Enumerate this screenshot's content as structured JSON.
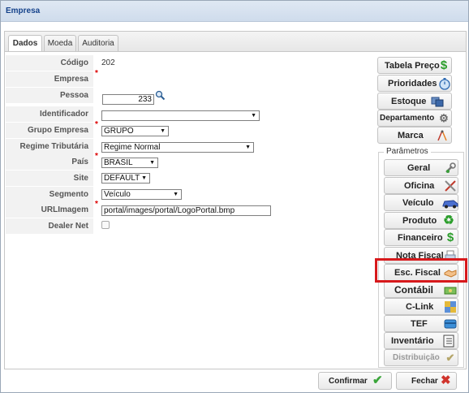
{
  "window": {
    "title": "Empresa"
  },
  "tabs": [
    {
      "label": "Dados",
      "active": true
    },
    {
      "label": "Moeda",
      "active": false
    },
    {
      "label": "Auditoria",
      "active": false
    }
  ],
  "form": {
    "codigo": {
      "label": "Código",
      "value": "202"
    },
    "empresa": {
      "label": "Empresa",
      "value": ""
    },
    "pessoa": {
      "label": "Pessoa",
      "value": "233"
    },
    "identificador": {
      "label": "Identificador",
      "value": ""
    },
    "grupo_empresa": {
      "label": "Grupo Empresa",
      "value": "GRUPO"
    },
    "regime_tributario": {
      "label": "Regime Tributária",
      "value": "Regime Normal"
    },
    "pais": {
      "label": "País",
      "value": "BRASIL"
    },
    "site": {
      "label": "Site",
      "value": "DEFAULT"
    },
    "segmento": {
      "label": "Segmento",
      "value": "Veículo"
    },
    "url_imagem": {
      "label": "URLImagem",
      "value": "portal/images/portal/LogoPortal.bmp"
    },
    "dealer_net": {
      "label": "Dealer Net",
      "checked": false
    }
  },
  "side_buttons": [
    {
      "label": "Tabela Preço",
      "icon": "dollar-icon"
    },
    {
      "label": "Prioridades",
      "icon": "stopwatch-icon"
    },
    {
      "label": "Estoque",
      "icon": "boxes-icon"
    },
    {
      "label": "Departamento",
      "icon": "gear-icon"
    },
    {
      "label": "Marca",
      "icon": "compass-icon"
    }
  ],
  "parametros": {
    "legend": "Parâmetros",
    "buttons": [
      {
        "label": "Geral",
        "icon": "wrench-icon"
      },
      {
        "label": "Oficina",
        "icon": "tools-icon"
      },
      {
        "label": "Veículo",
        "icon": "car-icon"
      },
      {
        "label": "Produto",
        "icon": "recycle-icon"
      },
      {
        "label": "Financeiro",
        "icon": "dollar-icon"
      },
      {
        "label": "Nota Fiscal",
        "icon": "printer-icon"
      },
      {
        "label": "Esc. Fiscal",
        "icon": "handshake-icon"
      },
      {
        "label": "Contábil",
        "icon": "cash-icon"
      },
      {
        "label": "C-Link",
        "icon": "puzzle-icon"
      },
      {
        "label": "TEF",
        "icon": "card-icon"
      },
      {
        "label": "Inventário",
        "icon": "checklist-icon"
      },
      {
        "label": "Distribuição",
        "icon": "check-icon"
      }
    ]
  },
  "footer": {
    "confirm_label": "Confirmar",
    "close_label": "Fechar"
  },
  "colors": {
    "highlight": "#d7191c",
    "title": "#15428b"
  }
}
